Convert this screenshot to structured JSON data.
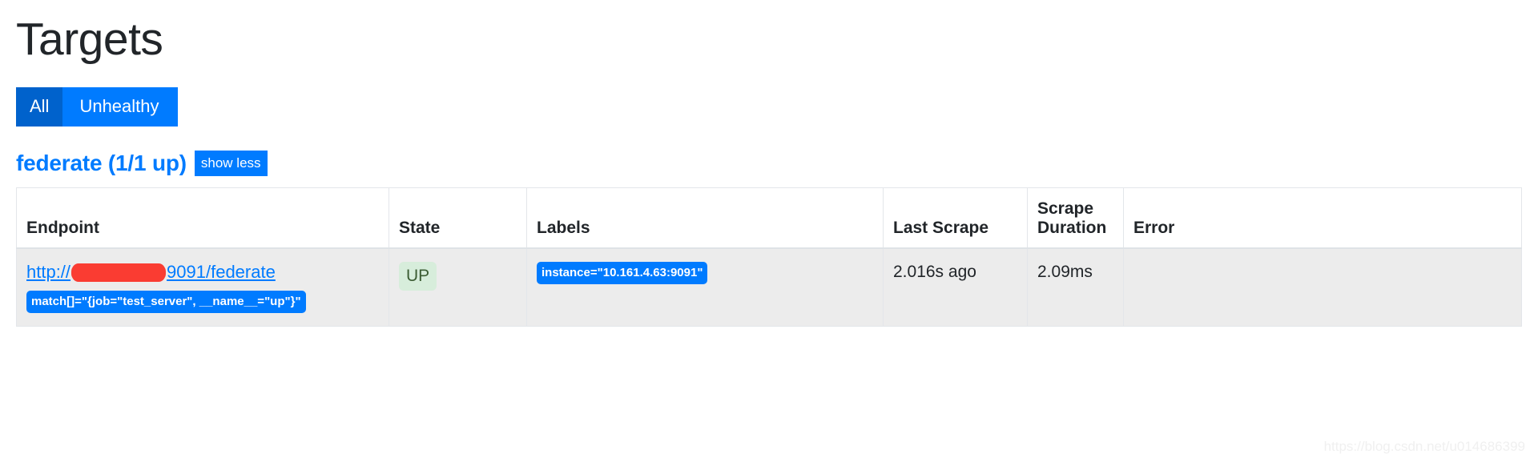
{
  "page": {
    "title": "Targets",
    "watermark": "https://blog.csdn.net/u014686399"
  },
  "filters": {
    "all_label": "All",
    "unhealthy_label": "Unhealthy",
    "active": "All",
    "active_color": "#0062cc",
    "inactive_color": "#007bff"
  },
  "job": {
    "heading": "federate (1/1 up)",
    "name": "federate",
    "up_count": 1,
    "total_count": 1,
    "toggle_label": "show less",
    "title_color": "#007bff"
  },
  "table": {
    "headers": [
      "Endpoint",
      "State",
      "Labels",
      "Last Scrape",
      "Scrape Duration",
      "Error"
    ],
    "rows": [
      {
        "endpoint": {
          "scheme": "http://",
          "host_redacted": true,
          "port_path": "9091/federate",
          "params_badge": "match[]=\"{job=\"test_server\", __name__=\"up\"}\""
        },
        "state": "UP",
        "state_bg": "#d7eddb",
        "state_fg": "#3c5d34",
        "labels": [
          "instance=\"10.161.4.63:9091\""
        ],
        "last_scrape": "2.016s ago",
        "scrape_duration": "2.09ms",
        "error": ""
      }
    ]
  }
}
